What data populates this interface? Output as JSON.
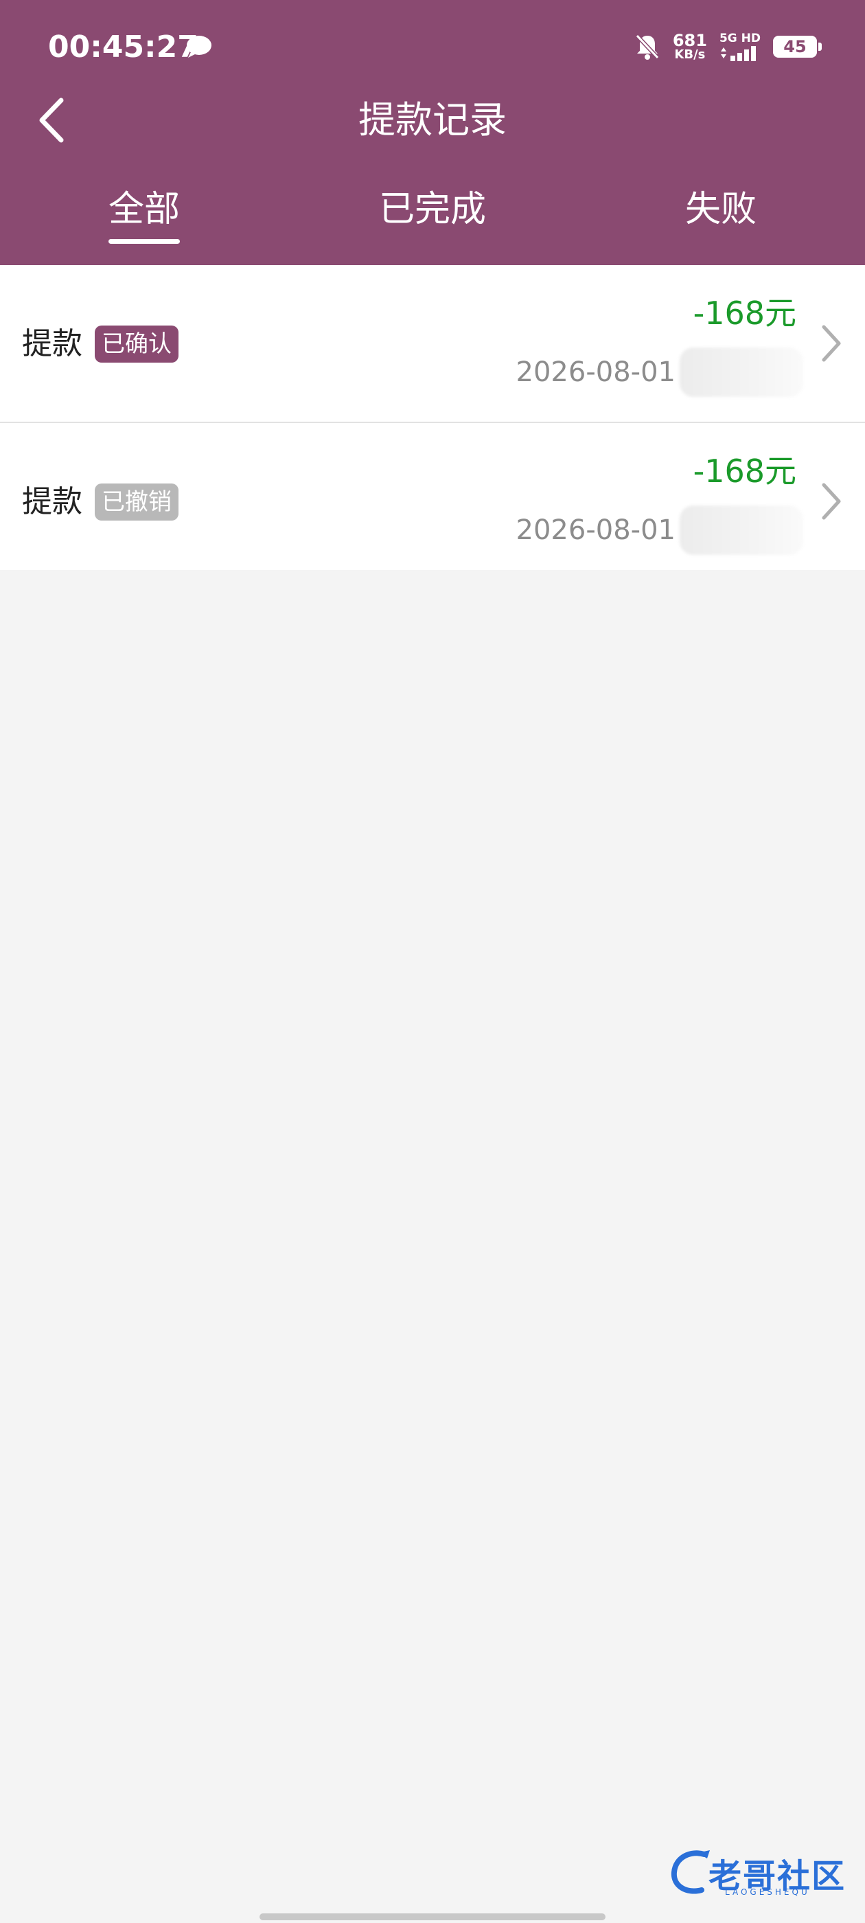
{
  "status_bar": {
    "time": "00:45:27",
    "net_speed_value": "681",
    "net_speed_unit": "KB/s",
    "signal_label": "5G HD",
    "battery": "45"
  },
  "nav": {
    "title": "提款记录",
    "back_icon": "chevron-left-icon"
  },
  "tabs": [
    {
      "label": "全部",
      "active": true
    },
    {
      "label": "已完成",
      "active": false
    },
    {
      "label": "失败",
      "active": false
    }
  ],
  "records": [
    {
      "type": "提款",
      "status": "已确认",
      "status_color": "#8a4a71",
      "amount": "-168元",
      "date": "2026-08-01"
    },
    {
      "type": "提款",
      "status": "已撤销",
      "status_color": "#b8b8b8",
      "amount": "-168元",
      "date": "2026-08-01"
    }
  ],
  "watermark": {
    "text": "老哥社区",
    "subtext": "LAOGESHEQU"
  },
  "colors": {
    "header": "#8a4a71",
    "amount": "#1a9a2a",
    "background": "#f4f4f4"
  }
}
